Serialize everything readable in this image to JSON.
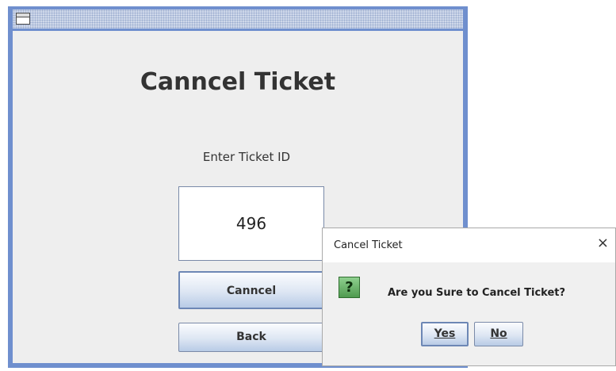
{
  "main_window": {
    "title": "Canncel Ticket",
    "ticket_label": "Enter Ticket ID",
    "ticket_id_value": "496",
    "cancel_button": "Canncel",
    "back_button": "Back"
  },
  "dialog": {
    "title": "Cancel Ticket",
    "close_glyph": "×",
    "icon_glyph": "?",
    "message": "Are you Sure to Cancel Ticket?",
    "yes_button": "Yes",
    "no_button": "No"
  },
  "icons": {
    "window_icon": "window-icon",
    "question_icon": "question-icon",
    "close_icon": "close-icon"
  },
  "colors": {
    "window_frame": "#6f8fce",
    "content_bg": "#eeeeee",
    "button_border": "#7a8aa8",
    "question_icon": "#4f9a4f"
  }
}
